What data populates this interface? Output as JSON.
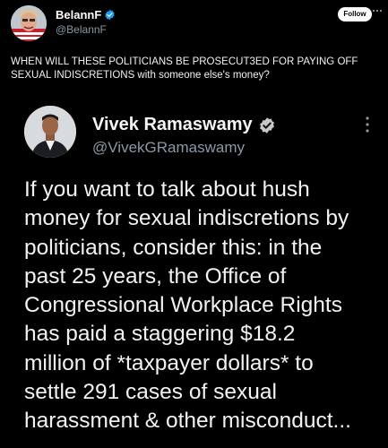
{
  "tweet": {
    "author_name": "BelannF",
    "author_handle": "@BelannF",
    "follow_label": "Follow",
    "more_icon": "more-horizontal-icon",
    "text": "WHEN WILL THESE POLITICIANS BE PROSECUT3ED FOR PAYING OFF\nSEXUAL INDISCRETIONS with someone else's money?",
    "colors": {
      "background": "#000000",
      "verified": "#1d9bf0",
      "secondary_text": "#8b98a5"
    }
  },
  "embedded": {
    "author_name": "Vivek Ramaswamy",
    "author_handle": "@VivekGRamaswamy",
    "verified_icon": "verified-badge-icon",
    "more_icon": "more-vertical-icon",
    "body_lines": [
      "If you want to talk about hush",
      "money for sexual indiscretions by",
      "politicians, consider this: in the",
      "past 25 years, the Office of",
      "Congressional Workplace Rights",
      "has paid a staggering $18.2",
      "million of *taxpayer dollars* to",
      "settle 291 cases of sexual",
      "harassment & other misconduct..."
    ]
  }
}
